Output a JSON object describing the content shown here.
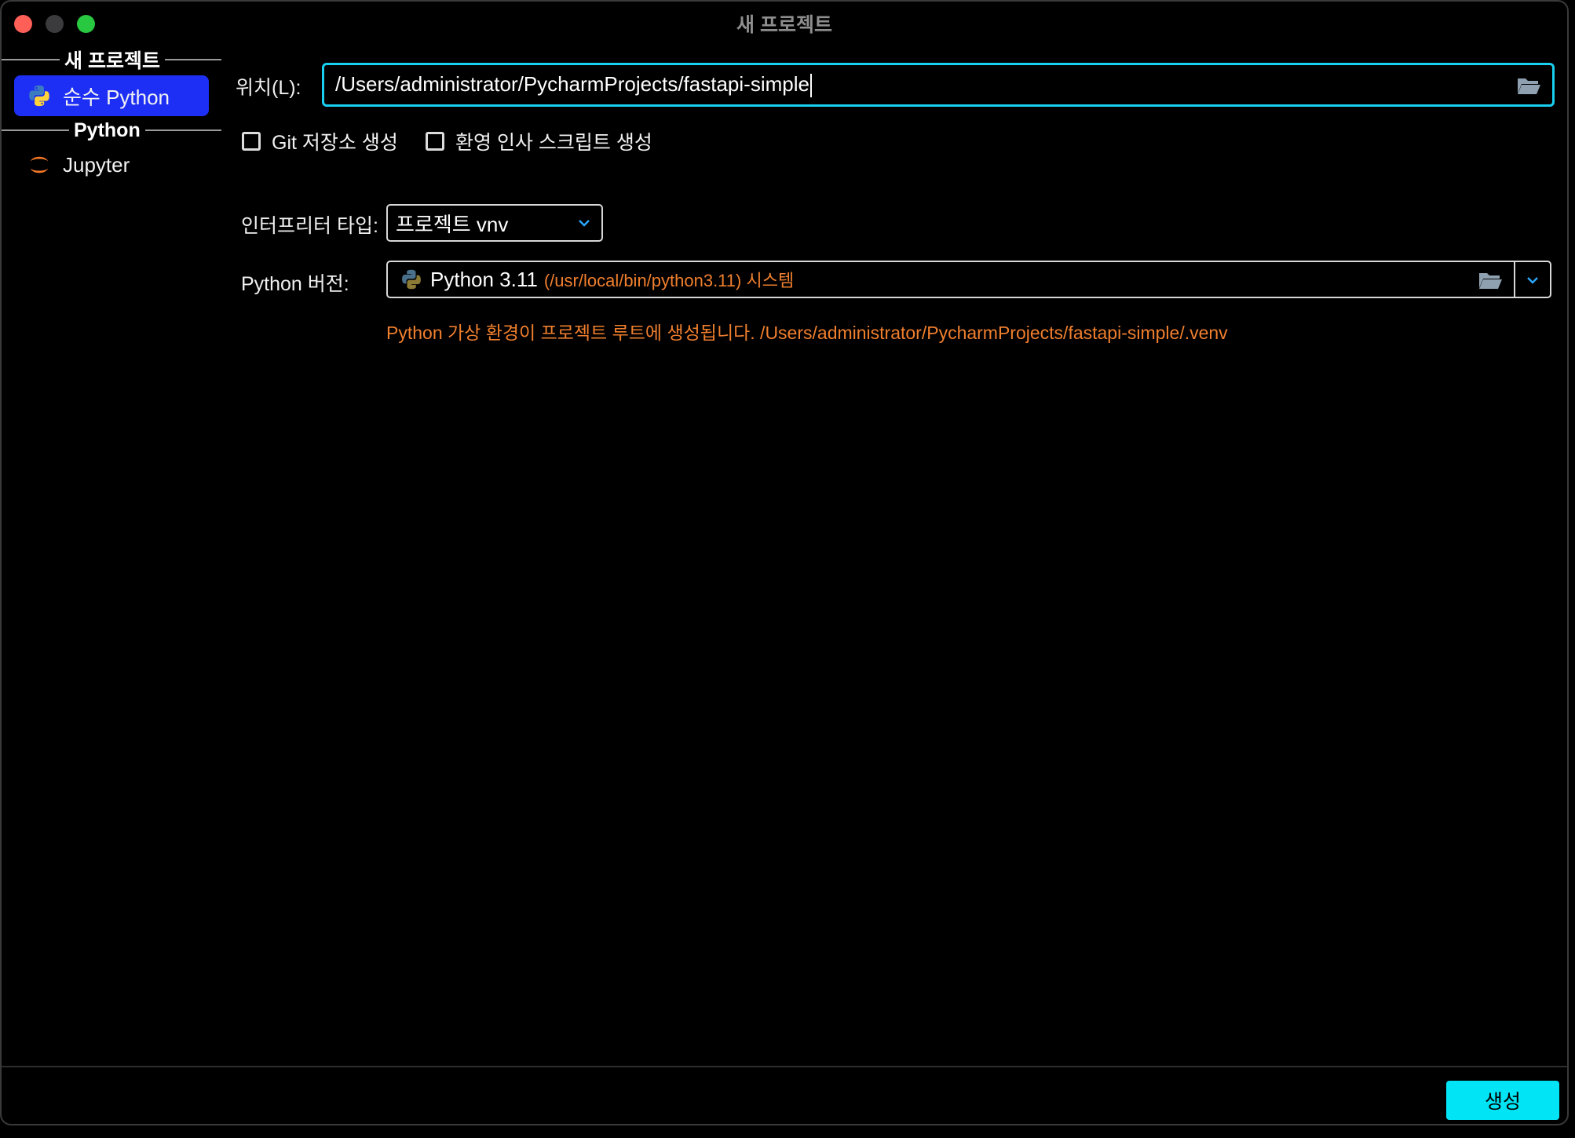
{
  "window": {
    "title": "새 프로젝트"
  },
  "sidebar": {
    "group_new_project": "새 프로젝트",
    "group_python": "Python",
    "items": [
      {
        "label": "순수 Python",
        "icon": "python-icon",
        "selected": true
      },
      {
        "label": "Jupyter",
        "icon": "jupyter-icon",
        "selected": false
      }
    ]
  },
  "form": {
    "location_label": "위치(L):",
    "location_value": "/Users/administrator/PycharmProjects/fastapi-simple",
    "git_checkbox_label": "Git 저장소 생성",
    "git_checked": false,
    "welcome_checkbox_label": "환영 인사 스크립트 생성",
    "welcome_checked": false,
    "interpreter_type_label": "인터프리터 타입:",
    "interpreter_type_value": "프로젝트 vnv",
    "python_version_label": "Python 버전:",
    "python_version_name": "Python 3.11",
    "python_version_path": "(/usr/local/bin/python3.11) 시스템",
    "venv_note": "Python 가상 환경이 프로젝트 루트에 생성됩니다. /Users/administrator/PycharmProjects/fastapi-simple/.venv"
  },
  "footer": {
    "create_label": "생성"
  },
  "colors": {
    "accent_cyan": "#00e4f5",
    "focus_border": "#19d0f0",
    "selection_blue": "#1e2ff5",
    "hint_orange": "#f07f2e",
    "close_red": "#fe5f57",
    "maximize_green": "#28c840"
  }
}
